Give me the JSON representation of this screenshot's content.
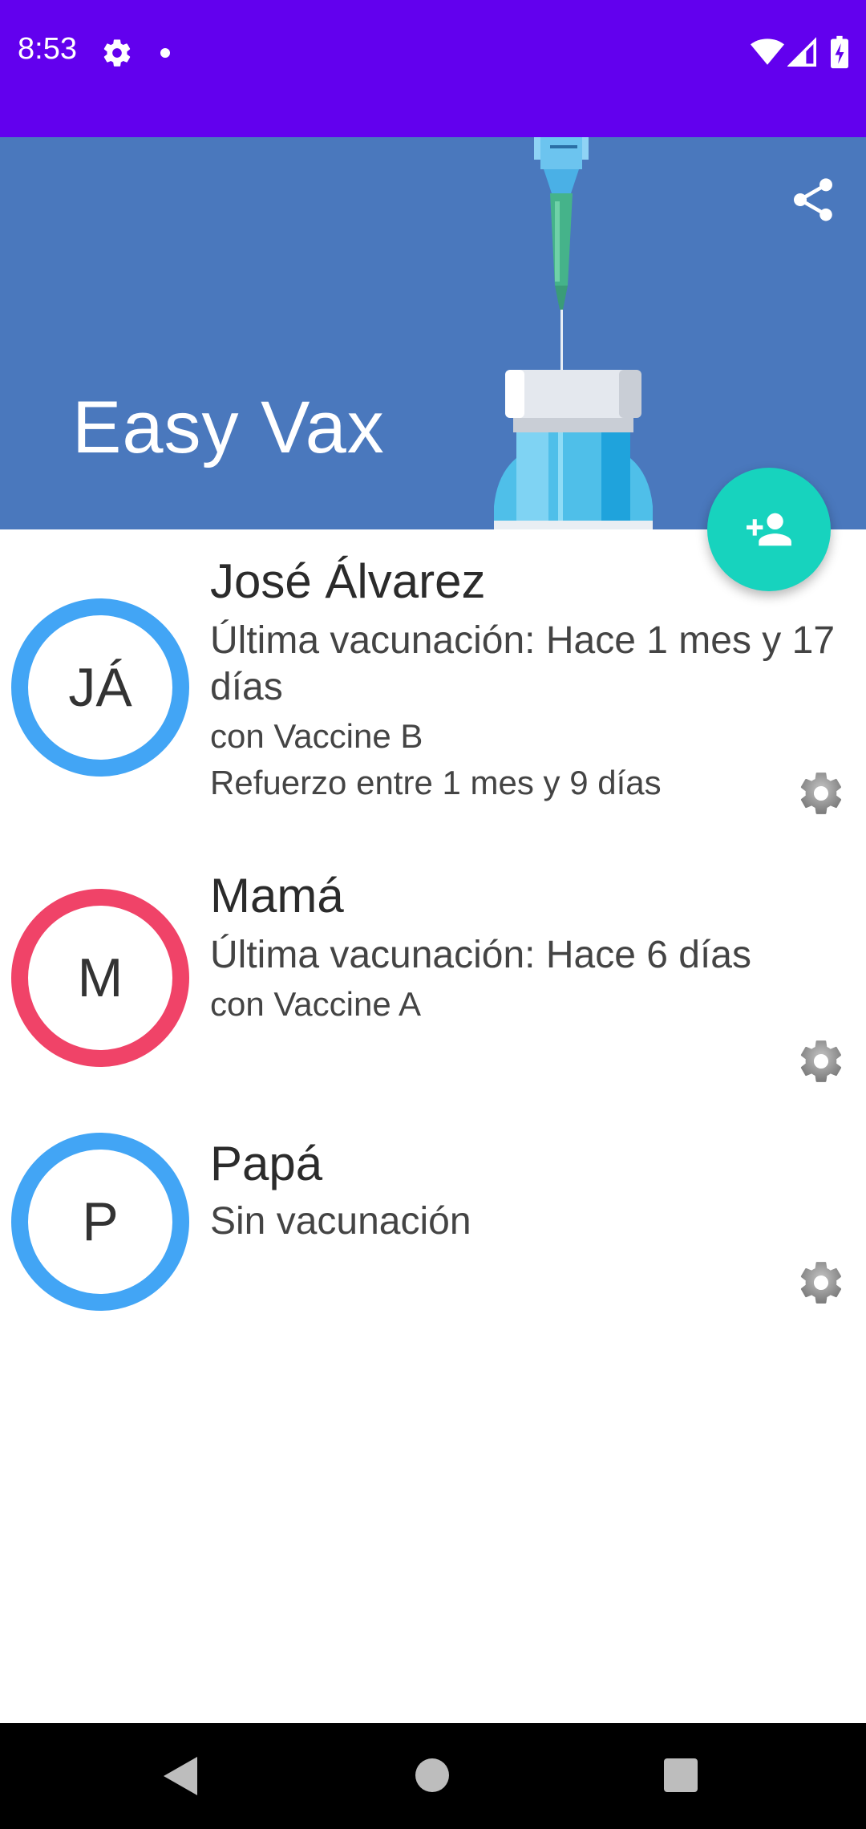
{
  "status_bar": {
    "time": "8:53",
    "icons": [
      "settings-icon",
      "notification-dot-icon",
      "wifi-icon",
      "signal-icon",
      "battery-charging-icon"
    ]
  },
  "header": {
    "title": "Easy Vax",
    "share_icon": "share-icon",
    "background_color": "#4A78BD"
  },
  "fab": {
    "icon": "add-person-icon",
    "color": "#17D3BE"
  },
  "people": [
    {
      "initials": "JÁ",
      "name": " José Álvarez",
      "last_vaccination": "Última vacunación: Hace 1 mes y 17 días",
      "vaccine": "con Vaccine B",
      "booster": "Refuerzo entre 1 mes y 9 días",
      "ring_color": "#42A5F5"
    },
    {
      "initials": "M",
      "name": "Mamá",
      "last_vaccination": "Última vacunación: Hace 6 días",
      "vaccine": "con Vaccine A",
      "booster": "",
      "ring_color": "#F04368"
    },
    {
      "initials": "P",
      "name": "Papá",
      "last_vaccination": "Sin vacunación",
      "vaccine": "",
      "booster": "",
      "ring_color": "#42A5F5"
    }
  ],
  "nav_bar": {
    "icons": [
      "back-icon",
      "home-icon",
      "recents-icon"
    ]
  }
}
